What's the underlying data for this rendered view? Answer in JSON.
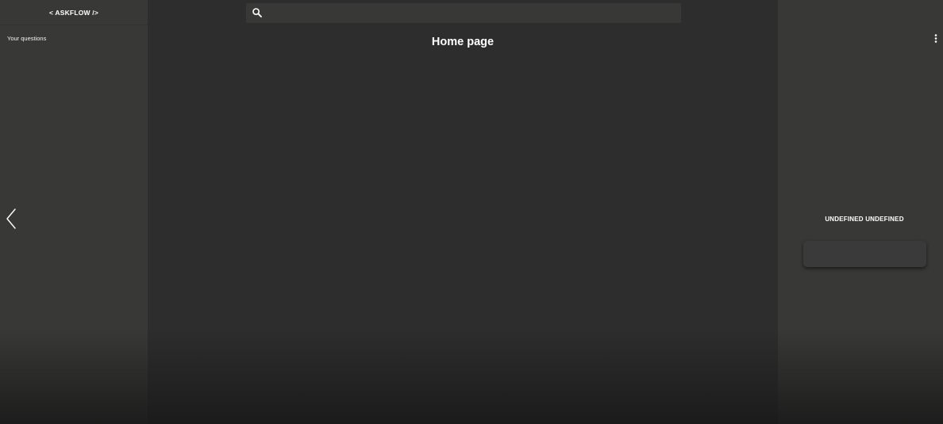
{
  "sidebar_left": {
    "brand": "< ASKFLOW />",
    "section_label": "Your questions",
    "collapse_icon": "chevron-left-icon"
  },
  "header": {
    "search": {
      "icon": "search-icon",
      "value": "",
      "placeholder": ""
    }
  },
  "main": {
    "title": "Home page"
  },
  "sidebar_right": {
    "menu_icon": "more-vertical-icon",
    "user_name": "UNDEFINED UNDEFINED"
  },
  "colors": {
    "sidebar_bg": "#383837",
    "main_bg": "#2e2d2d",
    "text": "#ffffff"
  }
}
